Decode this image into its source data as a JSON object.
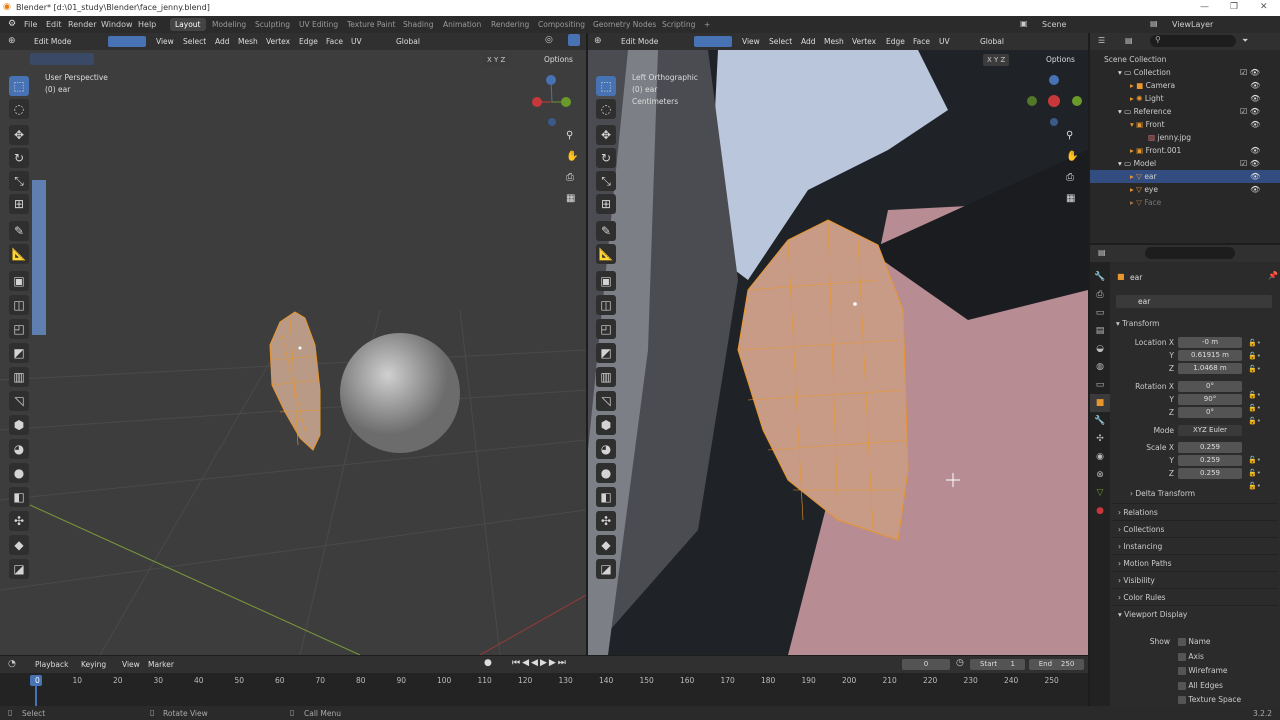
{
  "title": "Blender* [d:\\01_study\\Blender\\face_jenny.blend]",
  "menu": [
    "File",
    "Edit",
    "Render",
    "Window",
    "Help"
  ],
  "workspaces": [
    "Layout",
    "Modeling",
    "Sculpting",
    "UV Editing",
    "Texture Paint",
    "Shading",
    "Animation",
    "Rendering",
    "Compositing",
    "Geometry Nodes",
    "Scripting",
    "+"
  ],
  "scene": "Scene",
  "view_layer": "ViewLayer",
  "vp_left": {
    "mode": "Edit Mode",
    "menus": [
      "View",
      "Select",
      "Add",
      "Mesh",
      "Vertex",
      "Edge",
      "Face",
      "UV"
    ],
    "transform_orient": "Global",
    "title": "User Perspective",
    "subtitle": "(0) ear",
    "options": "Options"
  },
  "vp_right": {
    "mode": "Edit Mode",
    "menus": [
      "View",
      "Select",
      "Add",
      "Mesh",
      "Vertex",
      "Edge",
      "Face",
      "UV"
    ],
    "transform_orient": "Global",
    "title": "Left Orthographic",
    "subtitle": "(0) ear",
    "units": "Centimeters",
    "options": "Options"
  },
  "outliner": {
    "rows": [
      {
        "label": "Scene Collection",
        "indent": 0
      },
      {
        "label": "Collection",
        "indent": 1
      },
      {
        "label": "Camera",
        "indent": 2
      },
      {
        "label": "Light",
        "indent": 2
      },
      {
        "label": "Reference",
        "indent": 1
      },
      {
        "label": "Front",
        "indent": 2
      },
      {
        "label": "jenny.jpg",
        "indent": 3
      },
      {
        "label": "Front.001",
        "indent": 2
      },
      {
        "label": "Model",
        "indent": 1
      },
      {
        "label": "ear",
        "indent": 2
      },
      {
        "label": "eye",
        "indent": 2
      },
      {
        "label": "Face",
        "indent": 2
      }
    ]
  },
  "properties": {
    "object": "ear",
    "name": "ear",
    "transform": "Transform",
    "location_label": "Location X",
    "location": [
      "-0 m",
      "0.61915 m",
      "1.0468 m"
    ],
    "rotation_label": "Rotation X",
    "rotation": [
      "0°",
      "90°",
      "0°"
    ],
    "mode_label": "Mode",
    "mode": "XYZ Euler",
    "scale_label": "Scale X",
    "scale": [
      "0.259",
      "0.259",
      "0.259"
    ],
    "axis_y": "Y",
    "axis_z": "Z",
    "delta": "Delta Transform",
    "sections": [
      "Relations",
      "Collections",
      "Instancing",
      "Motion Paths",
      "Visibility",
      "Color Rules",
      "Viewport Display"
    ],
    "show_label": "Show",
    "show_items": [
      "Name",
      "Axis",
      "Wireframe",
      "All Edges",
      "Texture Space"
    ]
  },
  "timeline": {
    "menus": [
      "Playback",
      "Keying",
      "View",
      "Marker"
    ],
    "current": "0",
    "start_label": "Start",
    "start": "1",
    "end_label": "End",
    "end": "250",
    "ticks": [
      "0",
      "10",
      "20",
      "30",
      "40",
      "50",
      "60",
      "70",
      "80",
      "90",
      "100",
      "110",
      "120",
      "130",
      "140",
      "150",
      "160",
      "170",
      "180",
      "190",
      "200",
      "210",
      "220",
      "230",
      "240",
      "250"
    ]
  },
  "status": {
    "select": "Select",
    "rotate": "Rotate View",
    "call": "Call Menu",
    "version": "3.2.2"
  },
  "colors": {
    "accent": "#4772b3",
    "mesh": "#e8962e",
    "bg": "#3d3d3d"
  }
}
